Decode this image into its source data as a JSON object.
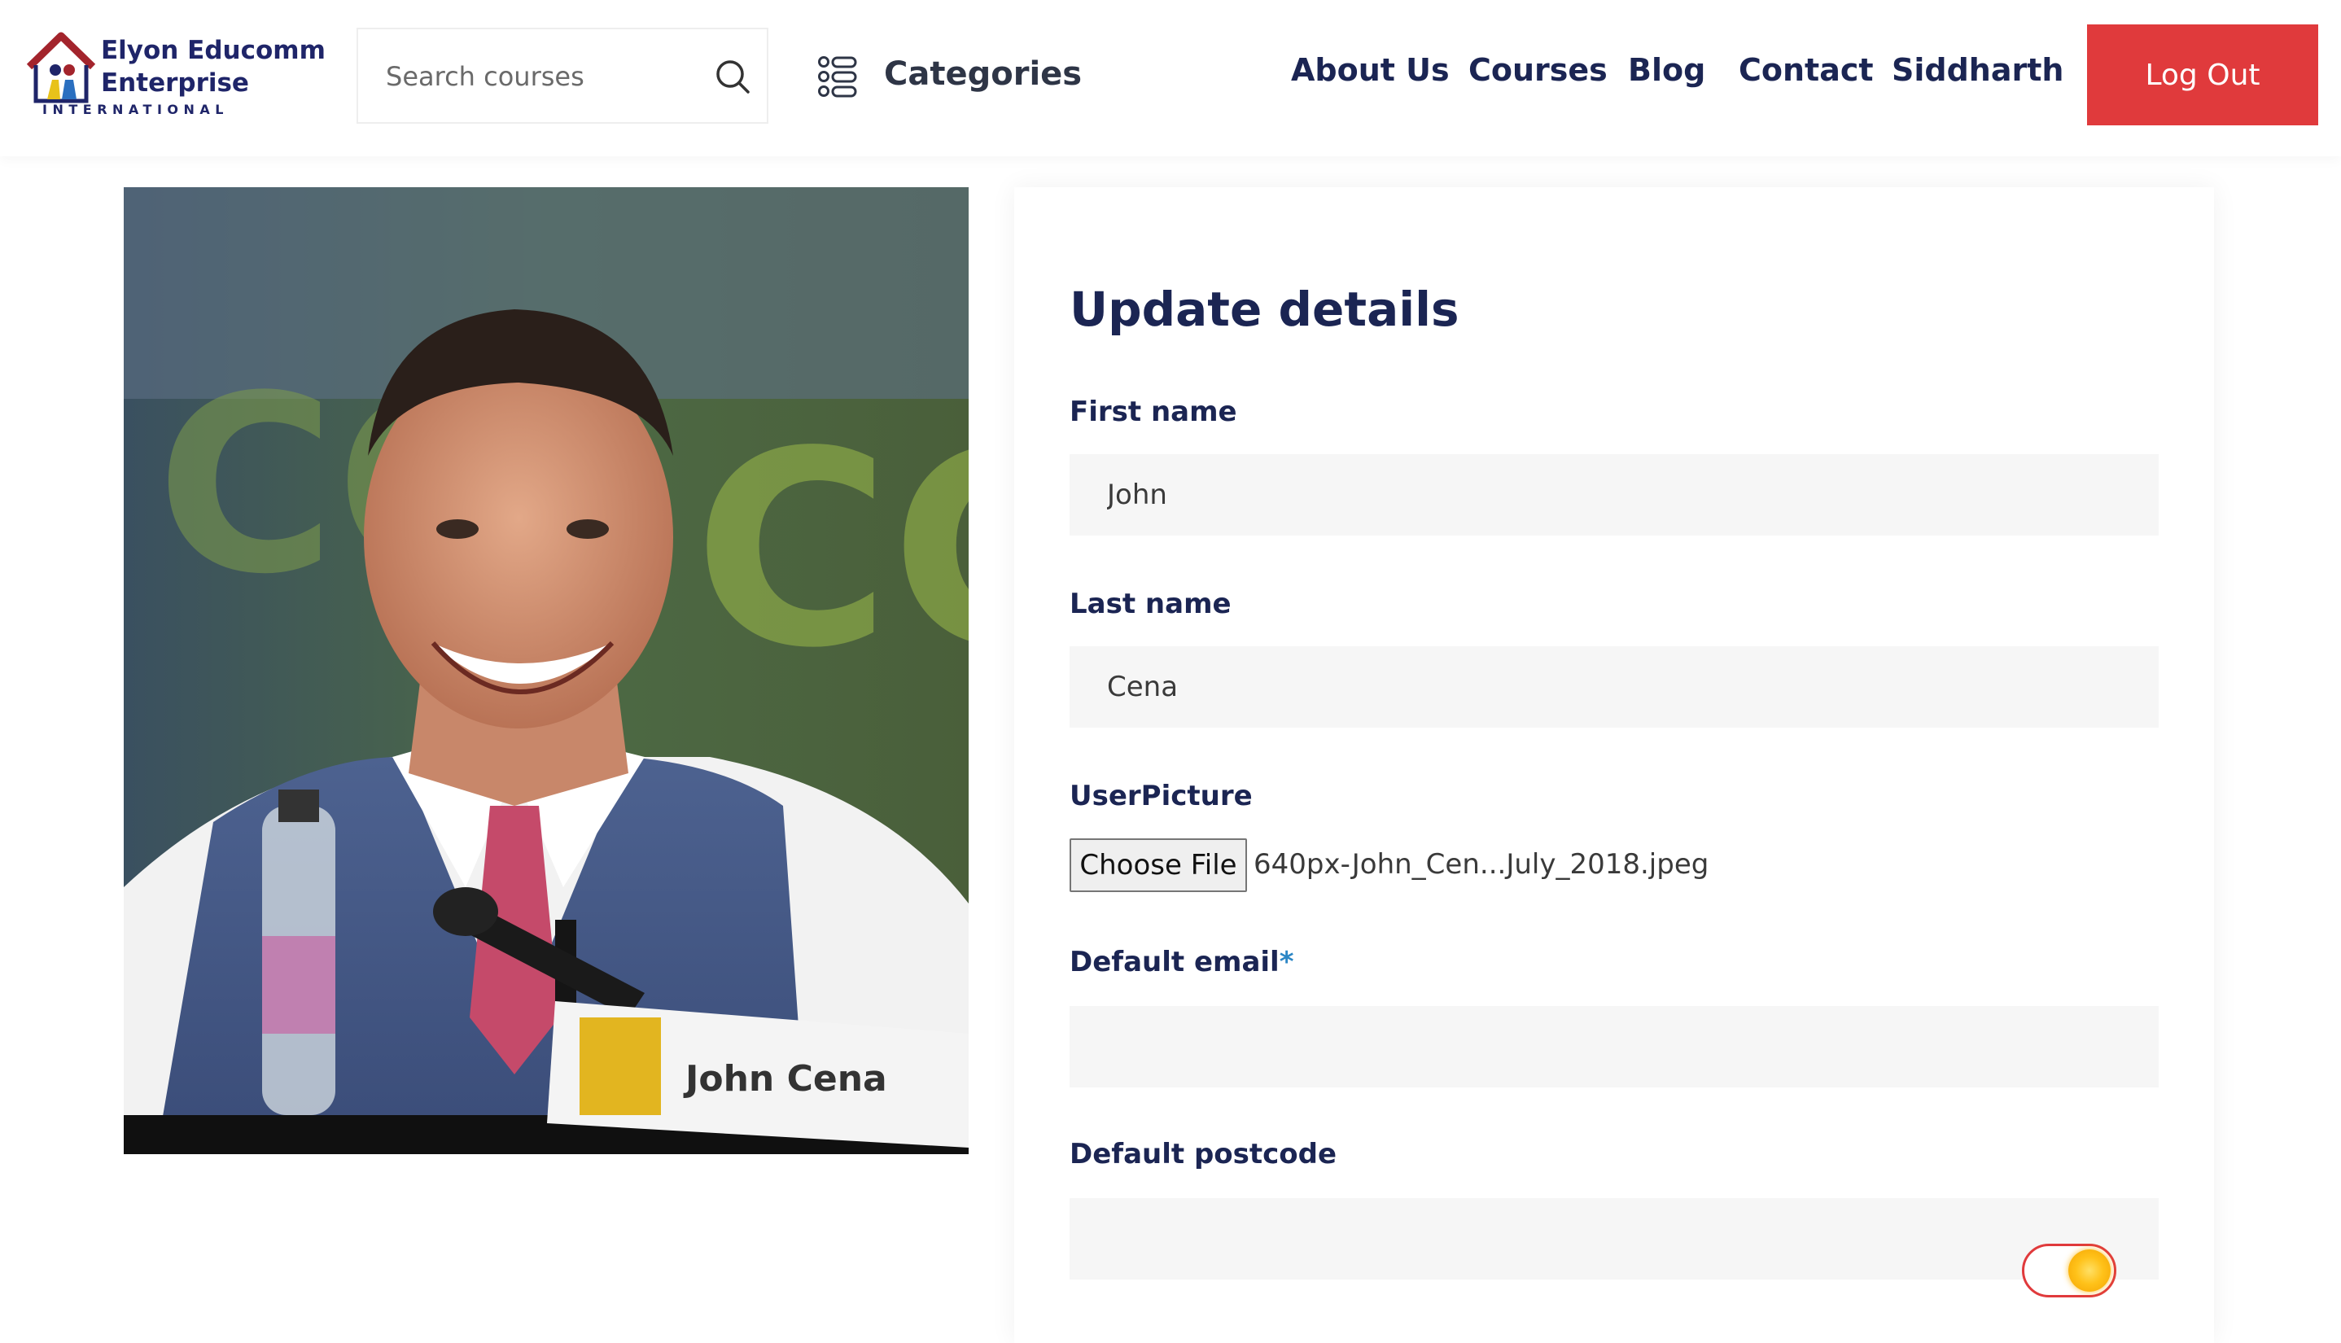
{
  "header": {
    "logo": {
      "line1": "Elyon Educomm",
      "line2": "Enterprise",
      "line3": "INTERNATIONAL"
    },
    "search": {
      "placeholder": "Search courses",
      "icon": "search-icon"
    },
    "categories": {
      "label": "Categories",
      "icon": "categories-grid-icon"
    },
    "nav": [
      "About Us",
      "Courses",
      "Blog",
      "Contact",
      "Siddharth"
    ],
    "logout_label": "Log Out"
  },
  "photo": {
    "placard_text": "John Cena"
  },
  "form": {
    "title": "Update details",
    "first_name": {
      "label": "First name",
      "value": "John"
    },
    "last_name": {
      "label": "Last name",
      "value": "Cena"
    },
    "user_picture": {
      "label": "UserPicture",
      "button_label": "Choose File",
      "file_name": "640px-John_Cen...July_2018.jpeg"
    },
    "default_email": {
      "label": "Default email",
      "required_mark": "*",
      "value": ""
    },
    "default_postcode": {
      "label": "Default postcode",
      "value": ""
    },
    "theme_toggle": {
      "icon": "sun-icon",
      "state": "on"
    }
  },
  "colors": {
    "brand_navy": "#1b2553",
    "accent_red": "#e03a3c",
    "required_blue": "#2b86c5",
    "input_bg": "#f6f6f6"
  }
}
